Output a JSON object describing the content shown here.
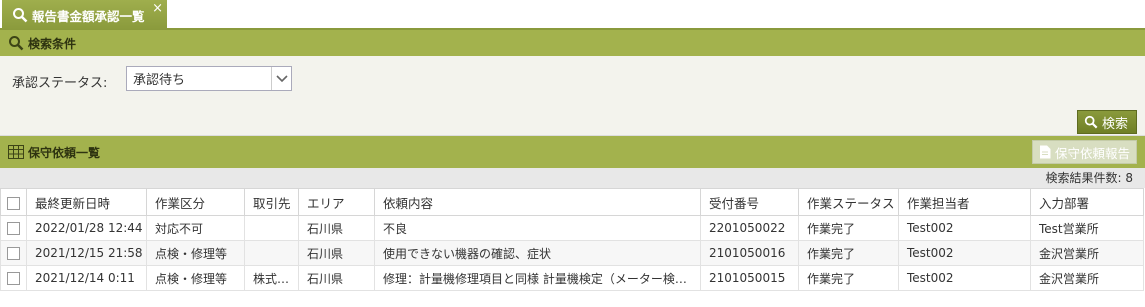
{
  "tab": {
    "label": "報告書金額承認一覧",
    "close": "×"
  },
  "search_section": {
    "title": "検索条件"
  },
  "filter": {
    "label": "承認ステータス:",
    "value": "承認待ち"
  },
  "search_button": {
    "label": "検索"
  },
  "list_section": {
    "title": "保守依頼一覧"
  },
  "report_button": {
    "label": "保守依頼報告"
  },
  "result_count": "検索結果件数: 8",
  "table": {
    "headers": [
      "最終更新日時",
      "作業区分",
      "取引先",
      "エリア",
      "依頼内容",
      "受付番号",
      "作業ステータス",
      "作業担当者",
      "入力部署"
    ],
    "rows": [
      [
        "2022/01/28 12:44",
        "対応不可",
        "",
        "石川県",
        "不良",
        "2201050022",
        "作業完了",
        "Test002",
        "Test営業所"
      ],
      [
        "2021/12/15 21:58",
        "点検・修理等",
        "",
        "石川県",
        "使用できない機器の確認、症状",
        "2101050016",
        "作業完了",
        "Test002",
        "金沢営業所"
      ],
      [
        "2021/12/14 0:11",
        "点検・修理等",
        "株式…",
        "石川県",
        "修理：計量機修理項目と同様 計量機検定（メーター検…",
        "2101050015",
        "作業完了",
        "Test002",
        "金沢営業所"
      ]
    ]
  },
  "colors": {
    "accent": "#a3b24d",
    "accent_dark": "#8a9a3c"
  },
  "icons": {
    "tab": "search-icon",
    "search_section": "search-icon",
    "list_section": "grid-icon",
    "report": "document-icon"
  }
}
